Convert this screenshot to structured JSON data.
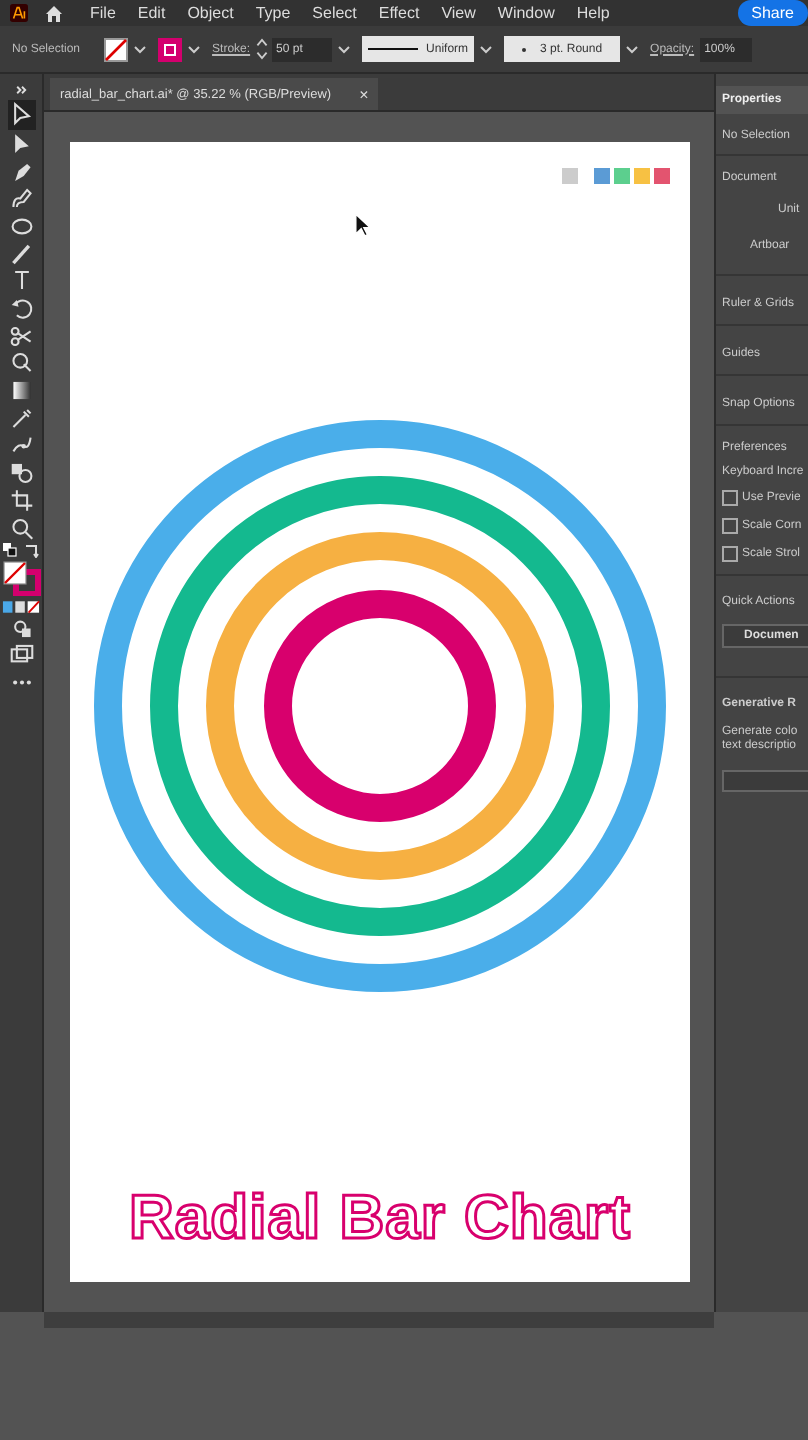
{
  "menu_bar": {
    "items": [
      "File",
      "Edit",
      "Object",
      "Type",
      "Select",
      "Effect",
      "View",
      "Window",
      "Help"
    ],
    "share_button": "Share"
  },
  "control_bar": {
    "selection": "No Selection",
    "stroke_label": "Stroke:",
    "stroke_weight": "50 pt",
    "profile": "Uniform",
    "brush": "3 pt. Round",
    "opacity_label": "Opacity:",
    "opacity": "100%"
  },
  "document_tab": {
    "title": "radial_bar_chart.ai* @ 35.22 % (RGB/Preview)",
    "close": "×"
  },
  "artboard": {
    "swatches": [
      {
        "color": "#cccccc"
      },
      {
        "color": "#5b9bd5"
      },
      {
        "color": "#5ccf8e"
      },
      {
        "color": "#f7c143"
      },
      {
        "color": "#e3546f"
      }
    ],
    "rings": [
      {
        "color": "#4aaeea"
      },
      {
        "color": "#14b98f"
      },
      {
        "color": "#f6b042"
      },
      {
        "color": "#d8006d"
      }
    ],
    "title": "Radial Bar Chart"
  },
  "properties_panel": {
    "tab": "Properties",
    "selection": "No Selection",
    "document": "Document",
    "units": "Unit",
    "artboard": "Artboar",
    "sections": [
      "Ruler & Grids",
      "Guides",
      "Snap Options"
    ],
    "preferences": "Preferences",
    "keyboard": "Keyboard Incre",
    "options": [
      {
        "label": "Use Previe",
        "checked": false
      },
      {
        "label": "Scale Corn",
        "checked": false
      },
      {
        "label": "Scale Strol",
        "checked": false
      }
    ],
    "quick_actions": "Quick Actions",
    "document_button": "Documen",
    "generative": "Generative R",
    "generative_text": "Generate colo text descriptio"
  }
}
